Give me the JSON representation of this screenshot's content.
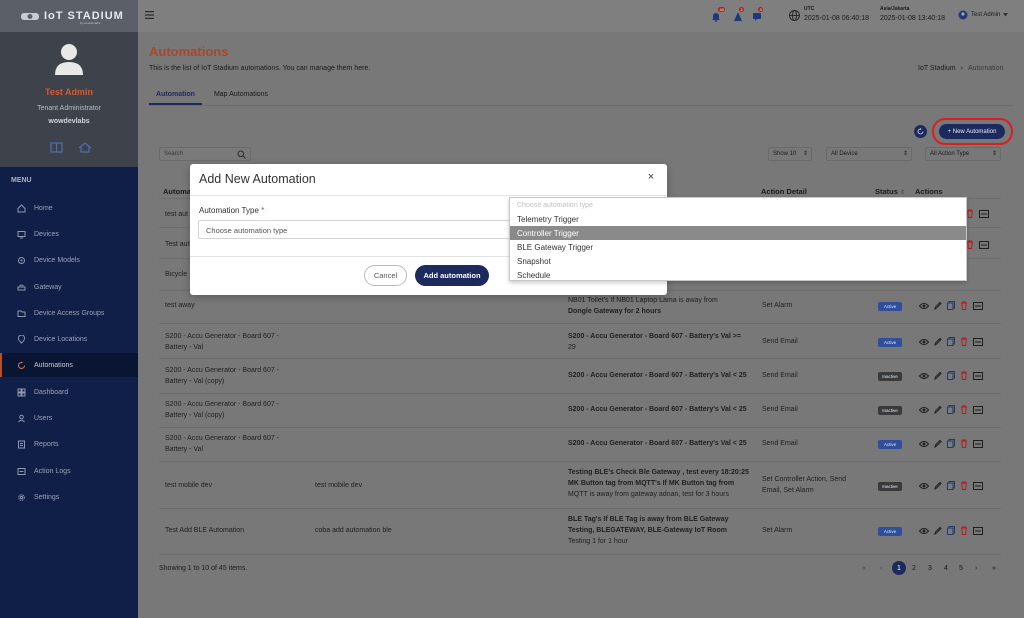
{
  "brand": {
    "name": "IoT STADIUM",
    "sub": "by wowdevlabs"
  },
  "user": {
    "name": "Test Admin",
    "role": "Tenant Administrator",
    "org": "wowdevlabs"
  },
  "sidebar": {
    "menu_label": "MENU",
    "items": [
      {
        "label": "Home",
        "icon": "home-icon"
      },
      {
        "label": "Devices",
        "icon": "devices-icon"
      },
      {
        "label": "Device Models",
        "icon": "device-models-icon"
      },
      {
        "label": "Gateway",
        "icon": "gateway-icon"
      },
      {
        "label": "Device Access Groups",
        "icon": "folder-icon"
      },
      {
        "label": "Device Locations",
        "icon": "location-pin-icon"
      },
      {
        "label": "Automations",
        "icon": "automation-icon"
      },
      {
        "label": "Dashboard",
        "icon": "dashboard-icon"
      },
      {
        "label": "Users",
        "icon": "users-icon"
      },
      {
        "label": "Reports",
        "icon": "reports-icon"
      },
      {
        "label": "Action Logs",
        "icon": "action-logs-icon"
      },
      {
        "label": "Settings",
        "icon": "gear-icon"
      }
    ]
  },
  "topbar": {
    "badges": [
      "40",
      "2",
      "3"
    ],
    "utc_label": "UTC",
    "utc_time": "2025-01-08 06:40:18",
    "local_label": "Asia/Jakarta",
    "local_time": "2025-01-08 13:40:18",
    "user_name": "Test Admin"
  },
  "page": {
    "title": "Automations",
    "subtitle": "This is the list of IoT Stadium automations. You can manage them here.",
    "breadcrumb": [
      "IoT Stadium",
      "Automation"
    ],
    "tabs": [
      "Automation",
      "Map Automations"
    ]
  },
  "toolbar": {
    "new_button": "+ New Automation",
    "search_placeholder": "Search",
    "show_select": "Show 10",
    "device_select": "All Device",
    "action_type_select": "All Action Type"
  },
  "table": {
    "headers": {
      "name": "Automa",
      "action": "Action Detail",
      "status": "Status",
      "actions": "Actions"
    },
    "rows": [
      {
        "name": "test aut",
        "device": "",
        "trigger": [],
        "action": "",
        "status": "",
        "status_color": ""
      },
      {
        "name": "Test aut",
        "device": "",
        "trigger": [],
        "action": "",
        "status": "",
        "status_color": ""
      },
      {
        "name": "Bicycle",
        "device": "",
        "trigger": [],
        "action": "",
        "status": "",
        "status_color": ""
      },
      {
        "name": "test away",
        "device": "",
        "trigger": [
          "NB01 Toilet's If NB01 Laptop Lama is away from",
          "Dongle Gateway for 2 hours"
        ],
        "action": "Set Alarm",
        "status": "Active",
        "status_color": "#2f4f9b"
      },
      {
        "name": "S200 - Accu Generator - Board 607 - Battery - Val",
        "device": "",
        "trigger": [
          "S200 - Accu Generator - Board 607 - Battery's Val >=",
          "29"
        ],
        "action": "Send Email",
        "status": "Active",
        "status_color": "#2f4f9b"
      },
      {
        "name": "S200 - Accu Generator - Board 607 - Battery - Val (copy)",
        "device": "",
        "trigger": [
          "S200 - Accu Generator - Board 607 - Battery's Val < 25"
        ],
        "action": "Send Email",
        "status": "Inactive",
        "status_color": "#3a3a3a"
      },
      {
        "name": "S200 - Accu Generator - Board 607 - Battery - Val (copy)",
        "device": "",
        "trigger": [
          "S200 - Accu Generator - Board 607 - Battery's Val < 25"
        ],
        "action": "Send Email",
        "status": "Inactive",
        "status_color": "#3a3a3a"
      },
      {
        "name": "S200 - Accu Generator - Board 607 - Battery - Val",
        "device": "",
        "trigger": [
          "S200 - Accu Generator - Board 607 - Battery's Val < 25"
        ],
        "action": "Send Email",
        "status": "Active",
        "status_color": "#2f4f9b"
      },
      {
        "name": "test mobile dev",
        "device": "test mobile dev",
        "trigger": [
          "Testing BLE's Check Ble Gateway , test every 18:20:25",
          "MK Button tag from MQTT's If MK Button tag from",
          "MQTT is away from gateway adnan, test for 3 hours"
        ],
        "action": "Set Controller Action, Send Email, Set Alarm",
        "status": "Inactive",
        "status_color": "#3a3a3a"
      },
      {
        "name": "Test Add BLE Automation",
        "device": "coba add automation ble",
        "trigger": [
          "BLE Tag's If BLE Tag is away from BLE Gateway",
          "Testing, BLEGATEWAY, BLE-Gateway IoT Room",
          "Testing 1 for 1 hour"
        ],
        "action": "Set Alarm",
        "status": "Active",
        "status_color": "#2f4f9b"
      }
    ]
  },
  "footer": {
    "showing": "Showing 1 to 10 of 45 items.",
    "pages": [
      "1",
      "2",
      "3",
      "4",
      "5"
    ],
    "first": "«",
    "prev": "‹",
    "next": "›",
    "last": "»"
  },
  "modal": {
    "title": "Add New Automation",
    "close": "×",
    "field_label": "Automation Type",
    "required_mark": "*",
    "placeholder": "Choose automation type",
    "cancel": "Cancel",
    "submit": "Add automation"
  },
  "dropdown": {
    "placeholder": "Choose automation type",
    "options": [
      "Telemetry Trigger",
      "Controller Trigger",
      "BLE Gateway Trigger",
      "Snapshot",
      "Schedule"
    ],
    "selected": "Controller Trigger"
  },
  "colors": {
    "accent": "#b3502e",
    "navy": "#1c2a5e",
    "highlight_ring": "#d91f26"
  }
}
